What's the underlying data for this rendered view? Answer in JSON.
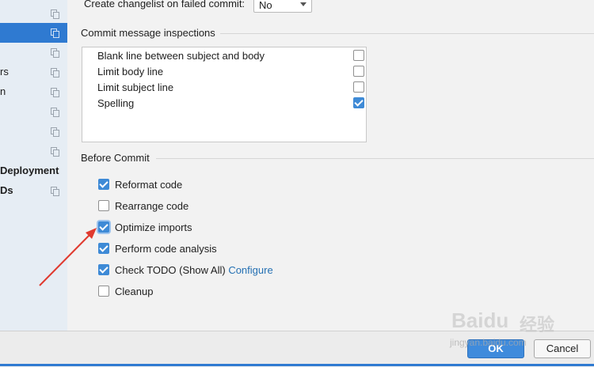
{
  "sidebar": {
    "items": [
      {
        "label": ""
      },
      {
        "label": ""
      },
      {
        "label": ""
      },
      {
        "label": "rs"
      },
      {
        "label": "n"
      },
      {
        "label": ""
      },
      {
        "label": ""
      },
      {
        "label": ""
      },
      {
        "label": "Deployment"
      },
      {
        "label": "Ds"
      }
    ]
  },
  "settings": {
    "changelist_label": "Create changelist on failed commit:",
    "changelist_value": "No"
  },
  "inspections": {
    "title": "Commit message inspections",
    "items": [
      {
        "label": "Blank line between subject and body",
        "checked": false
      },
      {
        "label": "Limit body line",
        "checked": false
      },
      {
        "label": "Limit subject line",
        "checked": false
      },
      {
        "label": "Spelling",
        "checked": true
      }
    ]
  },
  "before_commit": {
    "title": "Before Commit",
    "options": [
      {
        "label": "Reformat code",
        "checked": true
      },
      {
        "label": "Rearrange code",
        "checked": false
      },
      {
        "label": "Optimize imports",
        "checked": true
      },
      {
        "label": "Perform code analysis",
        "checked": true
      },
      {
        "label": "Check TODO (Show All)",
        "checked": true,
        "link": "Configure"
      },
      {
        "label": "Cleanup",
        "checked": false
      }
    ]
  },
  "footer": {
    "ok_label": "OK",
    "cancel_label": "Cancel"
  },
  "watermark": {
    "brand": "Baidu",
    "brand_cn": "经验",
    "site": "jingyan.baidu.com"
  },
  "colors": {
    "accent": "#2f7ad1",
    "link": "#2470b3",
    "arrow": "#e03a2f"
  }
}
